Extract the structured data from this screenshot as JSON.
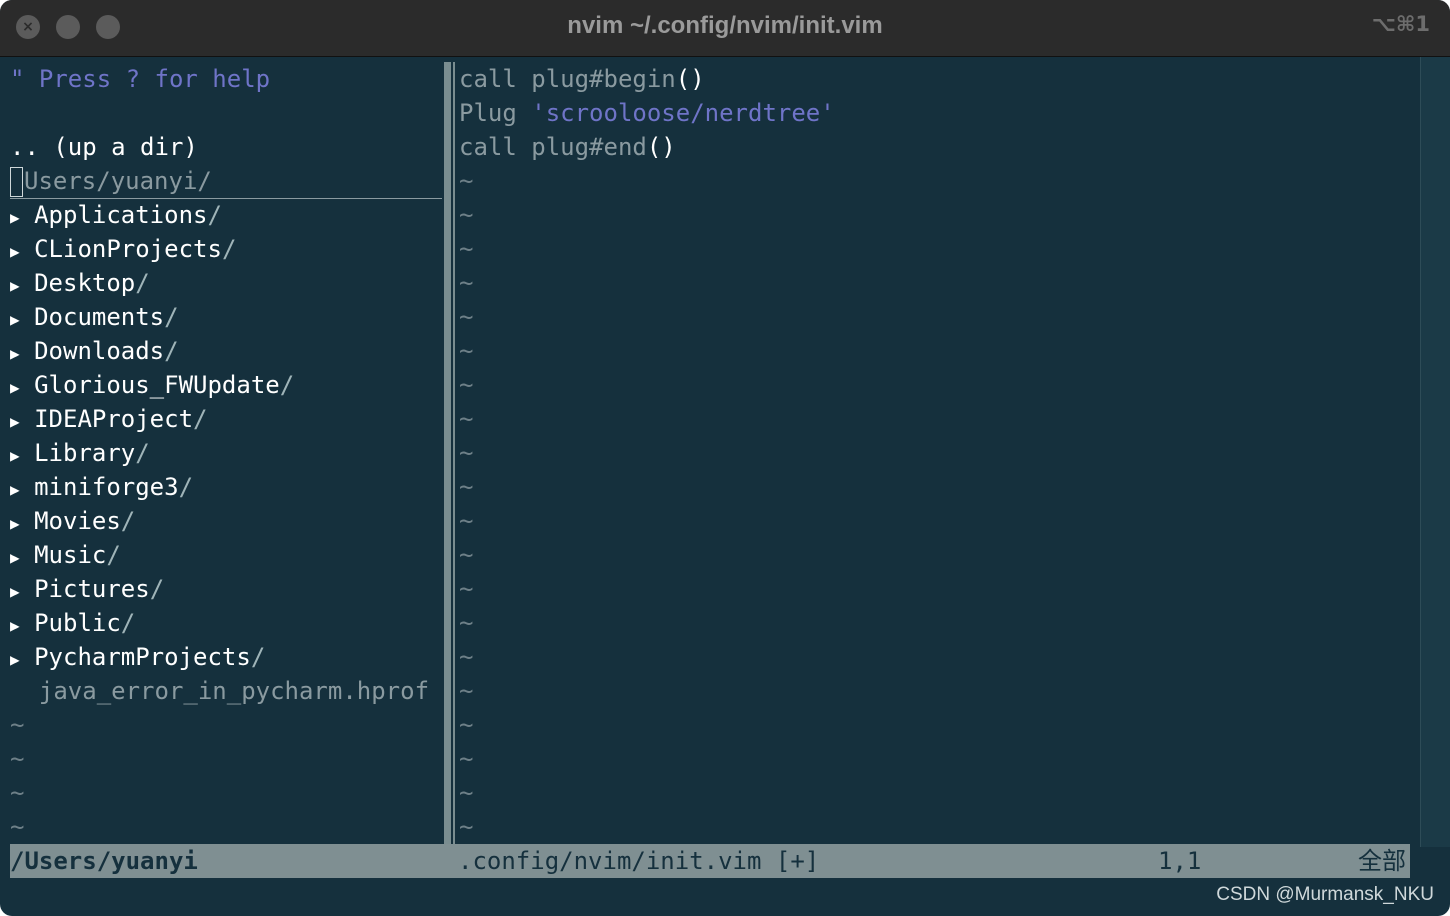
{
  "window": {
    "title": "nvim ~/.config/nvim/init.vim",
    "shortcut": "⌥⌘1"
  },
  "tree": {
    "help_line": "\" Press ? for help",
    "up_dir": ".. (up a dir)",
    "cwd": "/Users/yuanyi/",
    "dirs": [
      "Applications",
      "CLionProjects",
      "Desktop",
      "Documents",
      "Downloads",
      "Glorious_FWUpdate",
      "IDEAProject",
      "Library",
      "miniforge3",
      "Movies",
      "Music",
      "Pictures",
      "Public",
      "PycharmProjects"
    ],
    "dir_suffix": "/",
    "arrow": "▶",
    "file": "java_error_in_pycharm.hprof",
    "tilde": "~"
  },
  "editor": {
    "lines": [
      {
        "kw": "call",
        "rest": "plug#begin",
        "paren": "()"
      },
      {
        "kw": "Plug",
        "str": "'scrooloose/nerdtree'"
      },
      {
        "kw": "call",
        "rest": "plug#end",
        "paren": "()"
      }
    ],
    "tilde": "~"
  },
  "statusline": {
    "left": "/Users/yuanyi",
    "file": ".config/nvim/init.vim [+]",
    "position": "1,1",
    "scroll": "全部"
  },
  "watermark": "CSDN @Murmansk_NKU",
  "colors": {
    "background": "#15303d",
    "comment": "#6f74c8",
    "statusline": "#7f8f92"
  }
}
